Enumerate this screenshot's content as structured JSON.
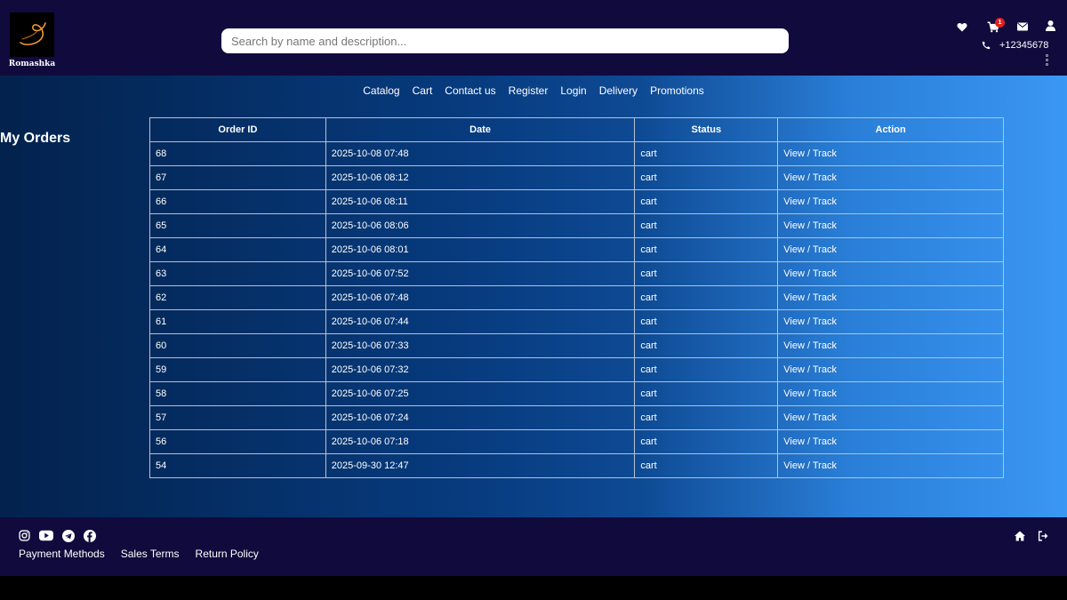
{
  "brand": {
    "name": "Romashka"
  },
  "header": {
    "search_placeholder": "Search by name and description...",
    "cart_badge": "1",
    "phone": "+12345678",
    "icons": [
      "heart-icon",
      "cart-icon",
      "envelope-icon",
      "user-icon",
      "phone-icon",
      "more-vertical-icon"
    ]
  },
  "nav": {
    "items": [
      "Catalog",
      "Cart",
      "Contact us",
      "Register",
      "Login",
      "Delivery",
      "Promotions"
    ]
  },
  "page": {
    "title": "My Orders"
  },
  "table": {
    "headers": [
      "Order ID",
      "Date",
      "Status",
      "Action"
    ],
    "rows": [
      {
        "id": "68",
        "date": "2025-10-08 07:48",
        "status": "cart",
        "action": "View / Track"
      },
      {
        "id": "67",
        "date": "2025-10-06 08:12",
        "status": "cart",
        "action": "View / Track"
      },
      {
        "id": "66",
        "date": "2025-10-06 08:11",
        "status": "cart",
        "action": "View / Track"
      },
      {
        "id": "65",
        "date": "2025-10-06 08:06",
        "status": "cart",
        "action": "View / Track"
      },
      {
        "id": "64",
        "date": "2025-10-06 08:01",
        "status": "cart",
        "action": "View / Track"
      },
      {
        "id": "63",
        "date": "2025-10-06 07:52",
        "status": "cart",
        "action": "View / Track"
      },
      {
        "id": "62",
        "date": "2025-10-06 07:48",
        "status": "cart",
        "action": "View / Track"
      },
      {
        "id": "61",
        "date": "2025-10-06 07:44",
        "status": "cart",
        "action": "View / Track"
      },
      {
        "id": "60",
        "date": "2025-10-06 07:33",
        "status": "cart",
        "action": "View / Track"
      },
      {
        "id": "59",
        "date": "2025-10-06 07:32",
        "status": "cart",
        "action": "View / Track"
      },
      {
        "id": "58",
        "date": "2025-10-06 07:25",
        "status": "cart",
        "action": "View / Track"
      },
      {
        "id": "57",
        "date": "2025-10-06 07:24",
        "status": "cart",
        "action": "View / Track"
      },
      {
        "id": "56",
        "date": "2025-10-06 07:18",
        "status": "cart",
        "action": "View / Track"
      },
      {
        "id": "54",
        "date": "2025-09-30 12:47",
        "status": "cart",
        "action": "View / Track"
      }
    ]
  },
  "footer": {
    "social_icons": [
      "instagram-icon",
      "youtube-icon",
      "telegram-icon",
      "facebook-icon"
    ],
    "links": [
      "Payment Methods",
      "Sales Terms",
      "Return Policy"
    ],
    "right_icons": [
      "home-icon",
      "logout-icon"
    ]
  },
  "colors": {
    "header_bg": "#110a3d",
    "gradient_start": "#03224d",
    "gradient_end": "#3a97f3",
    "badge": "#e02020",
    "logo_accent": "#f29a2e"
  }
}
